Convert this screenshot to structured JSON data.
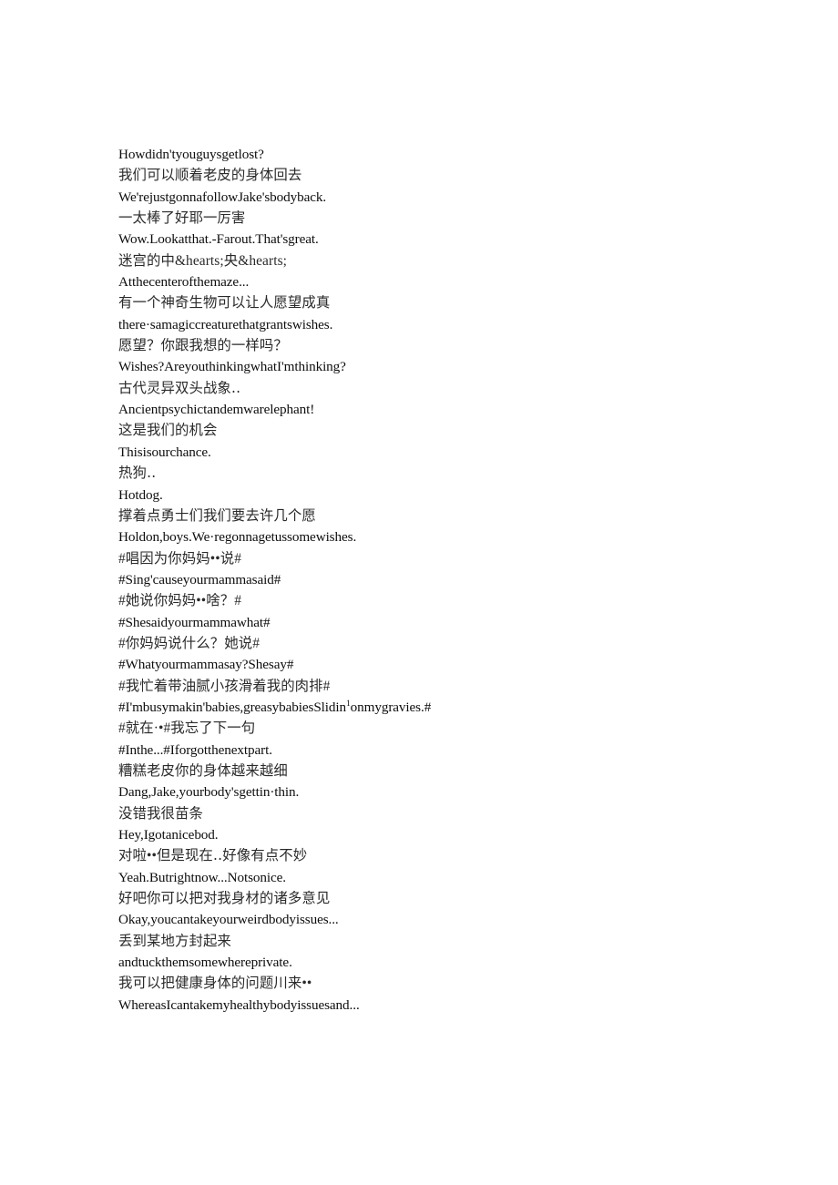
{
  "document": {
    "type": "bilingual-subtitle-transcript",
    "background_color": "#ffffff",
    "text_color": "#111111",
    "cjk_text_color": "#2a2a2a"
  },
  "transcript": {
    "lines": [
      {
        "script": "latin",
        "text": "Howdidn'tyouguysgetlost?"
      },
      {
        "script": "cjk",
        "text": "我们可以顺着老皮的身体回去"
      },
      {
        "script": "latin",
        "text": "We'rejustgonnafollowJake'sbodyback."
      },
      {
        "script": "cjk",
        "text": "一太棒了好耶一厉害"
      },
      {
        "script": "latin",
        "text": "Wow.Lookatthat.-Farout.That'sgreat."
      },
      {
        "script": "cjk",
        "text": "迷宫的中&hearts;央&hearts;"
      },
      {
        "script": "latin",
        "text": "Atthecenterofthemaze..."
      },
      {
        "script": "cjk",
        "text": "有一个神奇生物可以让人愿望成真"
      },
      {
        "script": "latin",
        "text": "there·samagiccreaturethatgrantswishes."
      },
      {
        "script": "cjk",
        "text": "愿望？你跟我想的一样吗？"
      },
      {
        "script": "latin",
        "text": "Wishes?AreyouthinkingwhatI'mthinking?"
      },
      {
        "script": "cjk",
        "text": "古代灵异双头战象‥"
      },
      {
        "script": "latin",
        "text": "Ancientpsychictandemwarelephant!"
      },
      {
        "script": "cjk",
        "text": "这是我们的机会"
      },
      {
        "script": "latin",
        "text": "Thisisourchance."
      },
      {
        "script": "cjk",
        "text": "热狗‥"
      },
      {
        "script": "latin",
        "text": "Hotdog."
      },
      {
        "script": "cjk",
        "text": "撑着点勇士们我们要去许几个愿"
      },
      {
        "script": "latin",
        "text": "Holdon,boys.We·regonnagetussomewishes."
      },
      {
        "script": "cjk",
        "text": "#唱因为你妈妈••说#"
      },
      {
        "script": "latin",
        "text": "#Sing'causeyourmammasaid#"
      },
      {
        "script": "cjk",
        "text": "#她说你妈妈••啥？#"
      },
      {
        "script": "latin",
        "text": "#Shesaidyourmammawhat#"
      },
      {
        "script": "cjk",
        "text": "#你妈妈说什么？她说#"
      },
      {
        "script": "latin",
        "text": "#Whatyourmammasay?Shesay#"
      },
      {
        "script": "cjk",
        "text": "#我忙着带油腻小孩滑着我的肉排#"
      },
      {
        "script": "latin",
        "text": "#I'mbusymakin'babies,greasybabiesSlidin",
        "sup": "1",
        "text_after": "onmygravies.#"
      },
      {
        "script": "cjk",
        "text": "#就在·•#我忘了下一句"
      },
      {
        "script": "latin",
        "text": "#Inthe...#Iforgotthenextpart."
      },
      {
        "script": "cjk",
        "text": "糟糕老皮你的身体越来越细"
      },
      {
        "script": "latin",
        "text": "Dang,Jake,yourbody'sgettin·thin."
      },
      {
        "script": "cjk",
        "text": "没错我很苗条"
      },
      {
        "script": "latin",
        "text": "Hey,Igotanicebod."
      },
      {
        "script": "cjk",
        "text": "对啦••但是现在‥好像有点不妙"
      },
      {
        "script": "latin",
        "text": "Yeah.Butrightnow...Notsonice."
      },
      {
        "script": "cjk",
        "text": "好吧你可以把对我身材的诸多意见"
      },
      {
        "script": "latin",
        "text": "Okay,youcantakeyourweirdbodyissues..."
      },
      {
        "script": "cjk",
        "text": "丢到某地方封起来"
      },
      {
        "script": "latin",
        "text": "andtuckthemsomewhereprivate."
      },
      {
        "script": "cjk",
        "text": "我可以把健康身体的问题川来••"
      },
      {
        "script": "latin",
        "text": "WhereasIcantakemyhealthybodyissuesand..."
      }
    ]
  }
}
